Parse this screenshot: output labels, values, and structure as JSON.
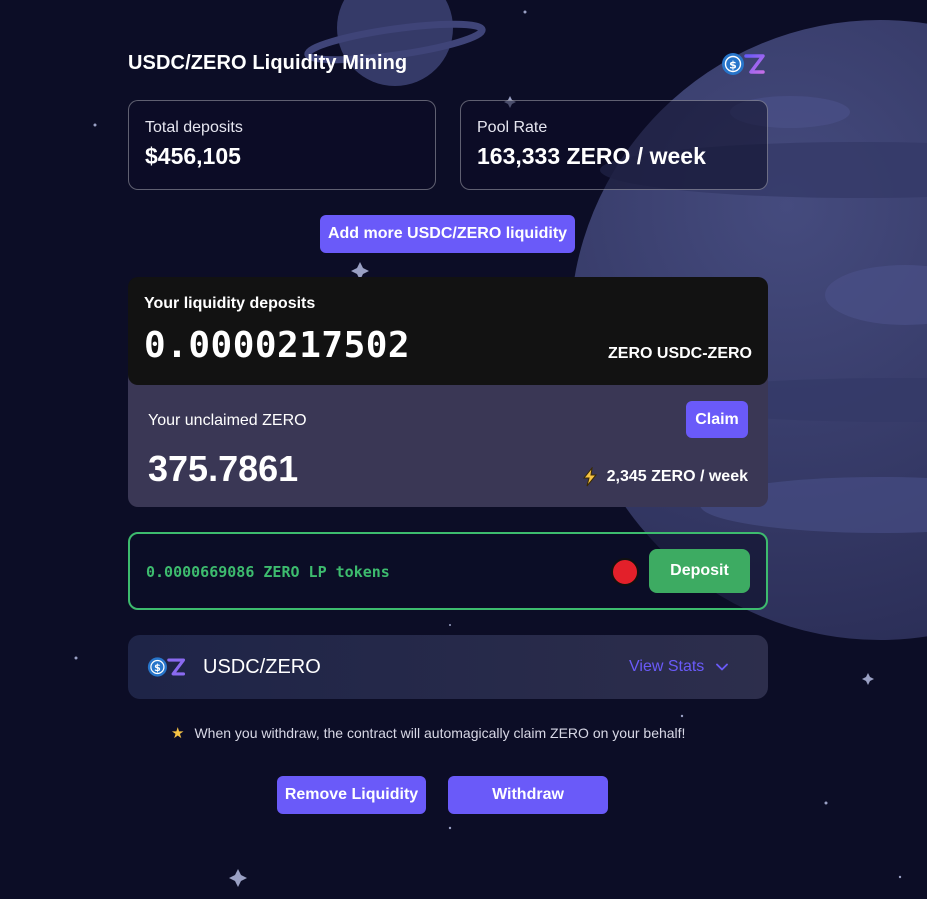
{
  "page": {
    "title": "USDC/ZERO Liquidity Mining"
  },
  "stats": {
    "total_deposits_label": "Total deposits",
    "total_deposits_value": "$456,105",
    "pool_rate_label": "Pool Rate",
    "pool_rate_value": "163,333 ZERO / week"
  },
  "actions": {
    "add_liquidity_label": "Add more USDC/ZERO liquidity",
    "remove_liquidity_label": "Remove Liquidity",
    "withdraw_label": "Withdraw"
  },
  "deposits": {
    "title": "Your liquidity deposits",
    "value": "0.0000217502",
    "unit": "ZERO USDC-ZERO"
  },
  "unclaimed": {
    "label": "Your unclaimed ZERO",
    "claim_label": "Claim",
    "value": "375.7861",
    "rate": "2,345 ZERO / week",
    "rate_icon": "lightning-icon"
  },
  "lp": {
    "tokens_text": "0.0000669086 ZERO LP tokens",
    "deposit_label": "Deposit",
    "accent_color": "#3dbb6e",
    "status_dot_color": "#e3202a"
  },
  "pool": {
    "name": "USDC/ZERO",
    "view_stats_label": "View Stats"
  },
  "notice": {
    "text": "When you withdraw, the contract will automagically claim ZERO on your behalf!",
    "icon": "star-icon"
  },
  "colors": {
    "background": "#0c0d26",
    "accent": "#6a5af9",
    "success": "#3dab62"
  }
}
